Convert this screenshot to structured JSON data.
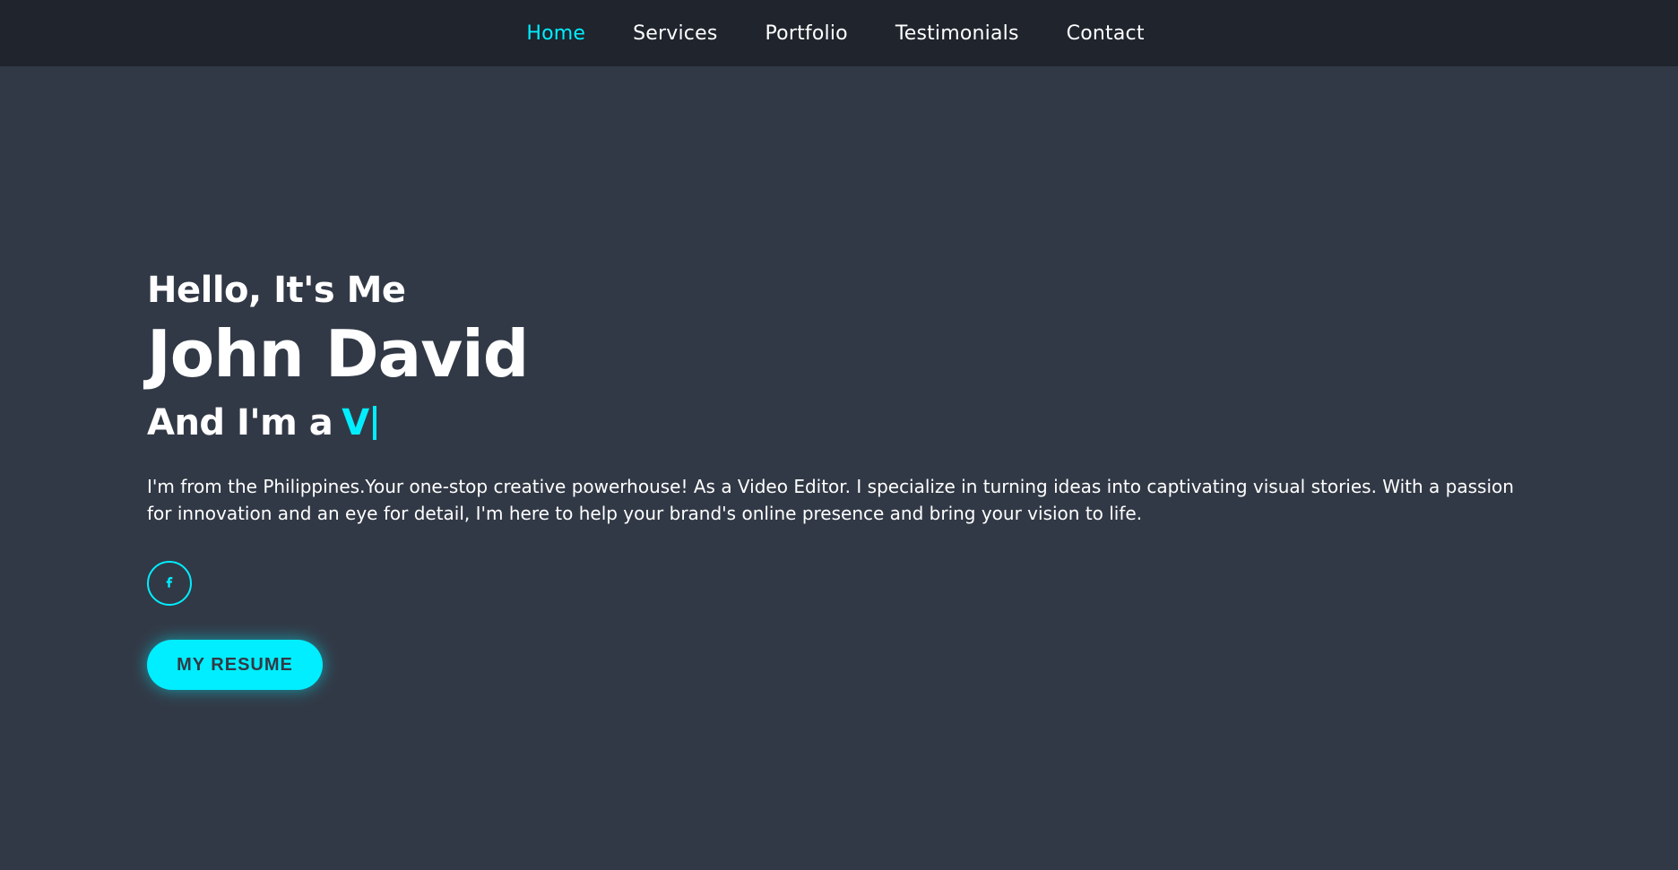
{
  "nav": {
    "items": [
      {
        "label": "Home",
        "active": true
      },
      {
        "label": "Services",
        "active": false
      },
      {
        "label": "Portfolio",
        "active": false
      },
      {
        "label": "Testimonials",
        "active": false
      },
      {
        "label": "Contact",
        "active": false
      }
    ]
  },
  "hero": {
    "greeting": "Hello, It's Me",
    "name": "John David",
    "role_prefix": "And I'm a",
    "role_typed": "V",
    "bio": "I'm from the Philippines.Your one-stop creative powerhouse! As a Video Editor. I specialize in turning ideas into captivating visual stories. With a passion for innovation and an eye for detail, I'm here to help your brand's online presence and bring your vision to life.",
    "socials": [
      {
        "icon": "facebook-icon"
      }
    ],
    "resume_label": "MY RESUME"
  },
  "theme": {
    "accent": "#00eeff",
    "background": "#323946",
    "navbar_background": "#1f242d",
    "text": "#ffffff"
  }
}
